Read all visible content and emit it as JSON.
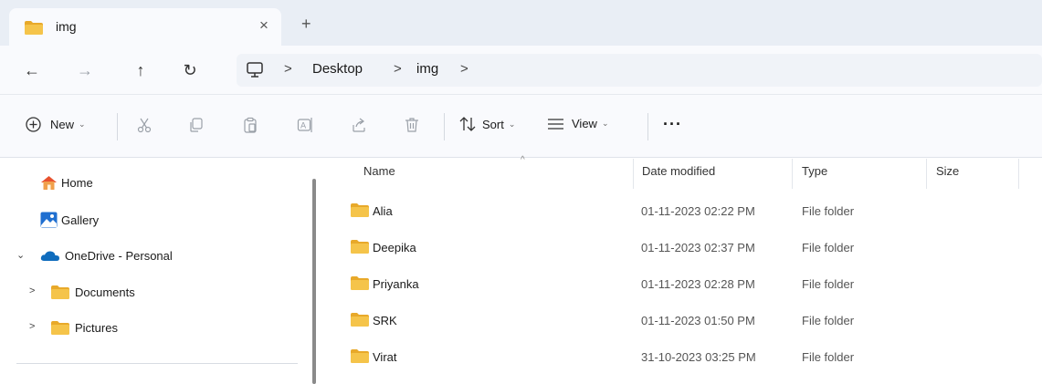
{
  "tab": {
    "title": "img",
    "close": "×",
    "new_tab": "+"
  },
  "nav": {
    "back": "←",
    "forward": "→",
    "up": "↑",
    "refresh": "↻"
  },
  "address": {
    "crumbs": [
      "Desktop",
      "img"
    ],
    "separator": ">"
  },
  "toolbar": {
    "new_label": "New",
    "sort_label": "Sort",
    "view_label": "View",
    "more_label": "···",
    "chevron": "⌄"
  },
  "sidebar": {
    "items": [
      {
        "label": "Home",
        "icon": "home-icon"
      },
      {
        "label": "Gallery",
        "icon": "gallery-icon"
      },
      {
        "label": "OneDrive - Personal",
        "icon": "cloud-icon",
        "expander": "⌄"
      },
      {
        "label": "Documents",
        "icon": "folder-icon",
        "expander": ">"
      },
      {
        "label": "Pictures",
        "icon": "folder-icon",
        "expander": ">"
      }
    ]
  },
  "filelist": {
    "columns": {
      "name": "Name",
      "date": "Date modified",
      "type": "Type",
      "size": "Size"
    },
    "sort_indicator": "^",
    "rows": [
      {
        "name": "Alia",
        "date": "01-11-2023 02:22 PM",
        "type": "File folder"
      },
      {
        "name": "Deepika",
        "date": "01-11-2023 02:37 PM",
        "type": "File folder"
      },
      {
        "name": "Priyanka",
        "date": "01-11-2023 02:28 PM",
        "type": "File folder"
      },
      {
        "name": "SRK",
        "date": "01-11-2023 01:50 PM",
        "type": "File folder"
      },
      {
        "name": "Virat",
        "date": "31-10-2023 03:25 PM",
        "type": "File folder"
      }
    ]
  },
  "colors": {
    "folder": "#f5c44a",
    "accent": "#0067c0",
    "tabstrip": "#e9eef5"
  }
}
